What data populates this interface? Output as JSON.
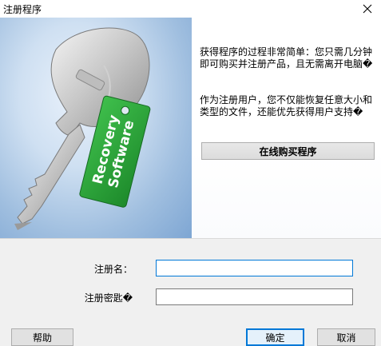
{
  "window": {
    "title": "注册程序"
  },
  "icons": {
    "close": "close-icon",
    "key": "key-illustration-icon"
  },
  "art": {
    "tag_line1": "Recovery",
    "tag_line2": "Software",
    "tag_color": "#2e9b3a"
  },
  "info": {
    "line1": "获得程序的过程非常简单：您只需几分钟",
    "line2": "即可购买并注册产品，且无需离开电脑�",
    "line3": "作为注册用户，您不仅能恢复任意大小和",
    "line4": "类型的文件，还能优先获得用户支持�"
  },
  "buy_button": {
    "label": "在线购买程序"
  },
  "form": {
    "name_label": "注册名：",
    "name_value": "",
    "key_label": "注册密匙�",
    "key_value": ""
  },
  "buttons": {
    "help": "帮助",
    "ok": "确定",
    "cancel": "取消"
  },
  "colors": {
    "accent": "#0078d7",
    "panel": "#f0f0f0"
  }
}
